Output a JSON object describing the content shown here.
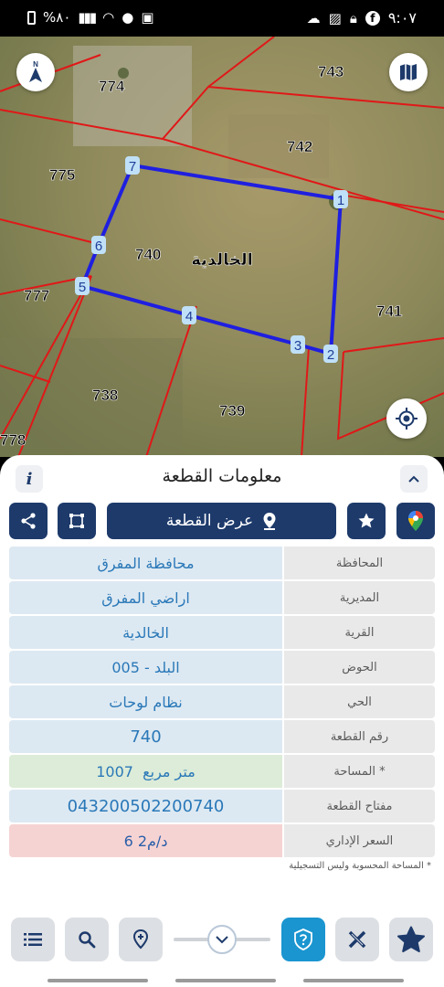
{
  "status_bar": {
    "battery": "%٨٠",
    "time": "٩:٠٧"
  },
  "map": {
    "plot_labels": [
      "743",
      "774",
      "742",
      "775",
      "740",
      "777",
      "741",
      "738",
      "739",
      "778"
    ],
    "village_label": "الخالدية",
    "vertices": [
      "1",
      "2",
      "3",
      "4",
      "5",
      "6",
      "7"
    ],
    "compass_letter": "N"
  },
  "panel": {
    "title": "معلومات القطعة",
    "show_plot_label": "عرض القطعة",
    "rows": [
      {
        "label": "المحافظة",
        "value": "محافظة المفرق"
      },
      {
        "label": "المديرية",
        "value": "اراضي المفرق"
      },
      {
        "label": "القرية",
        "value": "الخالدية"
      },
      {
        "label": "الحوض",
        "value": "البلد - 005"
      },
      {
        "label": "الحي",
        "value": "نظام لوحات"
      },
      {
        "label": "رقم القطعة",
        "value": "740"
      },
      {
        "label": "المساحة *",
        "value": "1007  متر مربع"
      },
      {
        "label": "مفتاح القطعة",
        "value": "043200502200740"
      },
      {
        "label": "السعر الإداري",
        "value": "6 د/م2"
      }
    ],
    "footnote": "* المساحة المحسوبة وليس التسجيلية"
  },
  "colors": {
    "navy": "#1d3a6b",
    "plot_outline": "#1f1fe0",
    "boundary_red": "#e01818",
    "accent_blue": "#1a95d0"
  },
  "icons": [
    "compass-icon",
    "map-layers-icon",
    "my-location-icon",
    "info-icon",
    "chevron-up-icon",
    "share-icon",
    "polygon-icon",
    "pin-icon",
    "star-icon",
    "google-maps-icon",
    "list-icon",
    "search-icon",
    "location-add-icon",
    "help-icon",
    "tools-icon",
    "favorite-icon"
  ]
}
